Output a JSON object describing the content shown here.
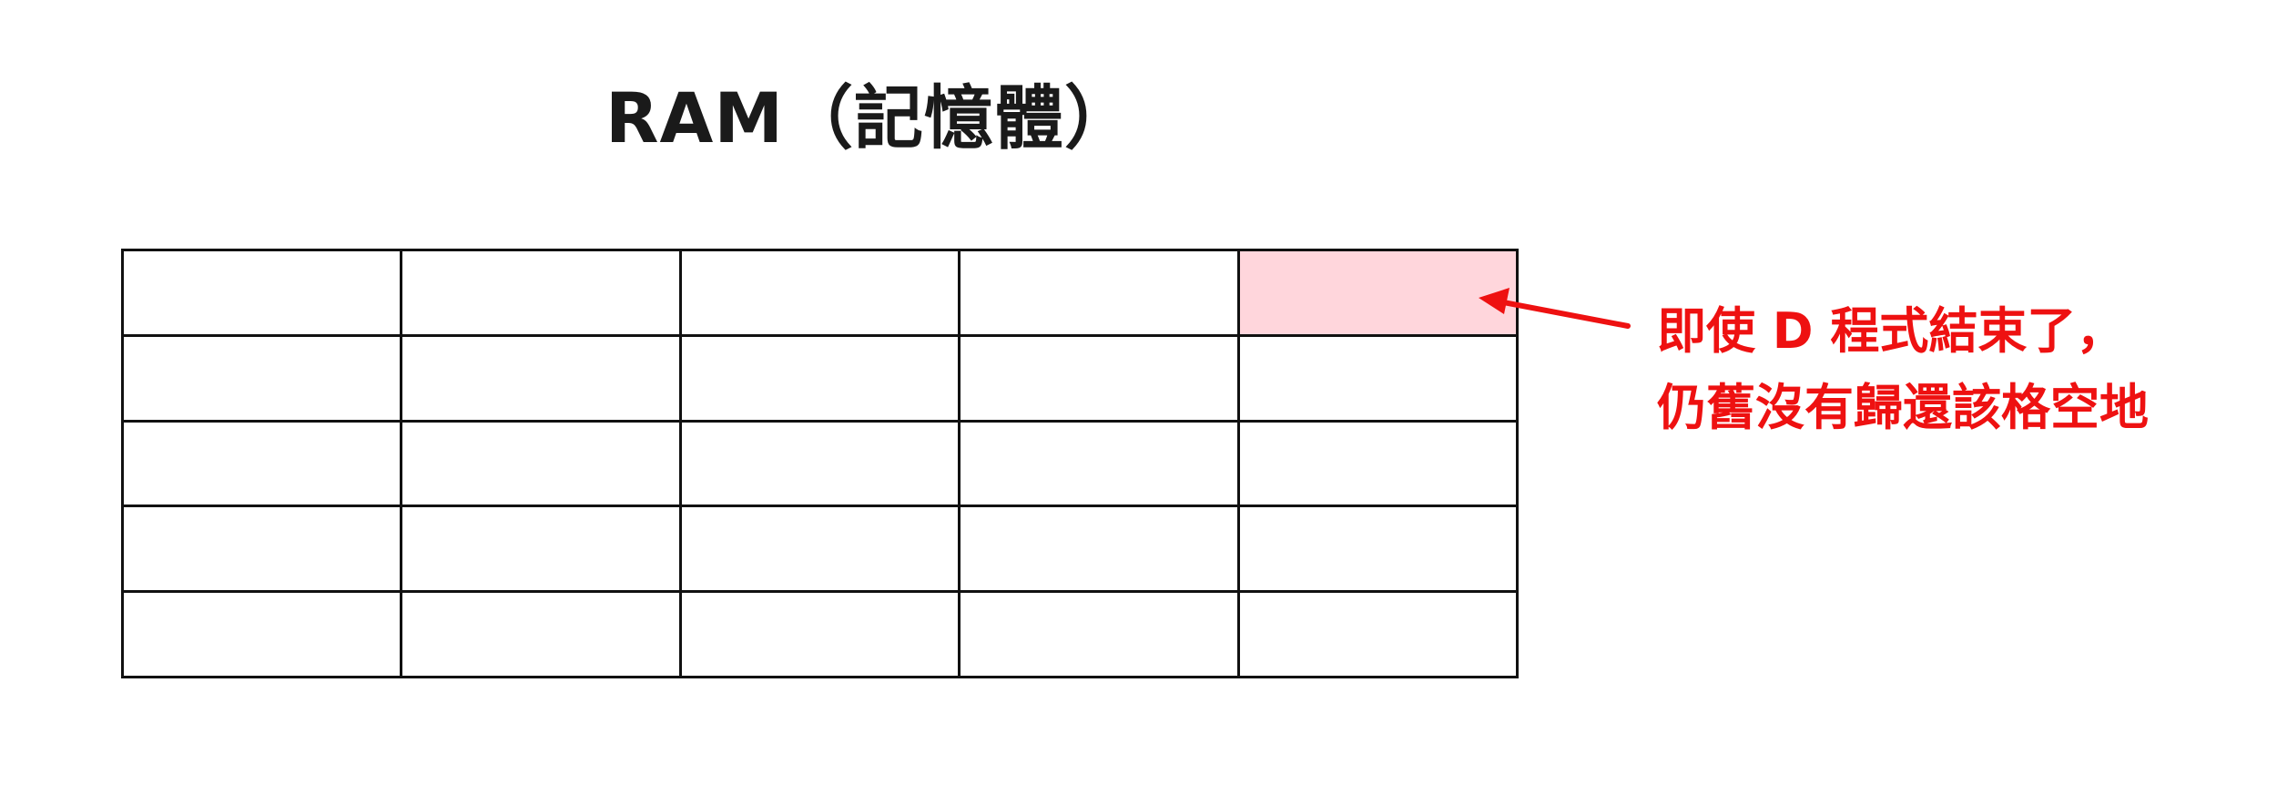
{
  "title": "RAM（記憶體）",
  "grid": {
    "rows": 5,
    "cols": 5,
    "highlighted_cell": {
      "row": 1,
      "col": 5
    },
    "highlight_color": "#ffd6dc"
  },
  "annotation": {
    "lines": [
      "即使 D 程式結束了，",
      "仍舊沒有歸還該格空地"
    ],
    "color": "#ee1111"
  }
}
